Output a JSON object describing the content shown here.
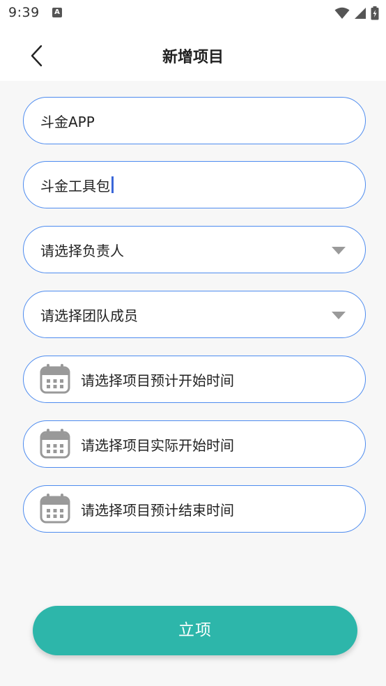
{
  "status_bar": {
    "time": "9:39",
    "notification_icon": "a-icon",
    "wifi_icon": "wifi-icon",
    "signal_icon": "signal-icon",
    "battery_icon": "battery-charging-icon"
  },
  "header": {
    "title": "新增项目",
    "back_icon": "chevron-left-icon"
  },
  "form": {
    "project_name": {
      "value": "斗金APP"
    },
    "project_desc": {
      "value": "斗金工具包"
    },
    "owner_select": {
      "placeholder": "请选择负责人",
      "icon": "triangle-down-icon"
    },
    "members_select": {
      "placeholder": "请选择团队成员",
      "icon": "triangle-down-icon"
    },
    "planned_start": {
      "placeholder": "请选择项目预计开始时间",
      "icon": "calendar-icon"
    },
    "actual_start": {
      "placeholder": "请选择项目实际开始时间",
      "icon": "calendar-icon"
    },
    "planned_end": {
      "placeholder": "请选择项目预计结束时间",
      "icon": "calendar-icon"
    }
  },
  "actions": {
    "submit_label": "立项"
  },
  "colors": {
    "field_border": "#4d8bef",
    "submit_bg": "#2db6aa",
    "caret": "#3a66d8",
    "background": "#f7f7f7"
  }
}
